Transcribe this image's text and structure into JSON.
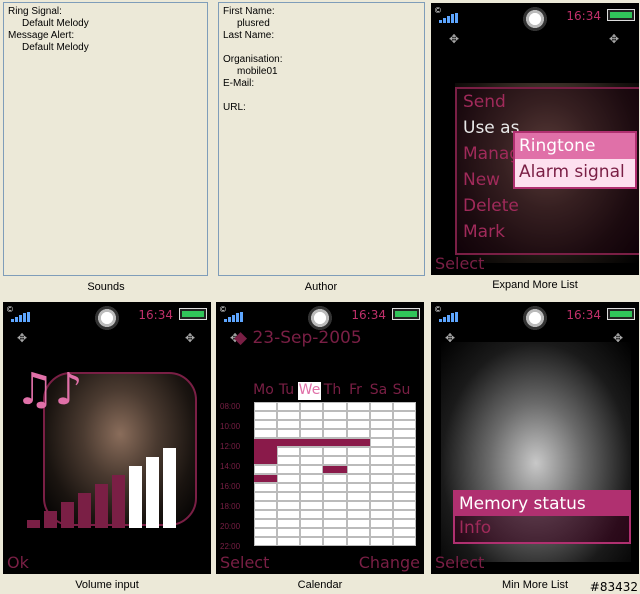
{
  "sounds": {
    "ring_signal_label": "Ring Signal:",
    "ring_signal_value": "Default Melody",
    "message_alert_label": "Message Alert:",
    "message_alert_value": "Default Melody",
    "caption": "Sounds"
  },
  "author": {
    "first_name_label": "First Name:",
    "first_name_value": "plusred",
    "last_name_label": "Last Name:",
    "organisation_label": "Organisation:",
    "organisation_value": "mobile01",
    "email_label": "E-Mail:",
    "url_label": "URL:",
    "caption": "Author"
  },
  "status": {
    "time": "16:34",
    "signal_glyph": "©"
  },
  "expand_more_list": {
    "caption": "Expand More List",
    "menu": [
      "Send",
      "Use as",
      "Manage",
      "New",
      "Delete",
      "Mark"
    ],
    "submenu": [
      "Ringtone",
      "Alarm signal"
    ],
    "softkey_left": "Select"
  },
  "volume_input": {
    "caption": "Volume input",
    "level_bars": 9,
    "level_filled": 6,
    "softkey_left": "Ok"
  },
  "calendar": {
    "caption": "Calendar",
    "date": "23-Sep-2005",
    "days": [
      "Mo",
      "Tu",
      "We",
      "Th",
      "Fr",
      "Sa",
      "Su"
    ],
    "selected_day": "We",
    "hours": [
      "08:00",
      "10:00",
      "12:00",
      "14:00",
      "16:00",
      "18:00",
      "20:00",
      "22:00"
    ],
    "softkey_left": "Select",
    "softkey_right": "Change"
  },
  "min_more_list": {
    "caption": "Min More List",
    "menu": [
      "Memory status",
      "Info"
    ],
    "softkey_left": "Select"
  },
  "watermark": "#83432",
  "colors": {
    "accent": "#b03070",
    "highlight": "#e070a8",
    "menu_text": "#a02a5a",
    "battery": "#31c45a",
    "signal": "#5ea6ff"
  }
}
